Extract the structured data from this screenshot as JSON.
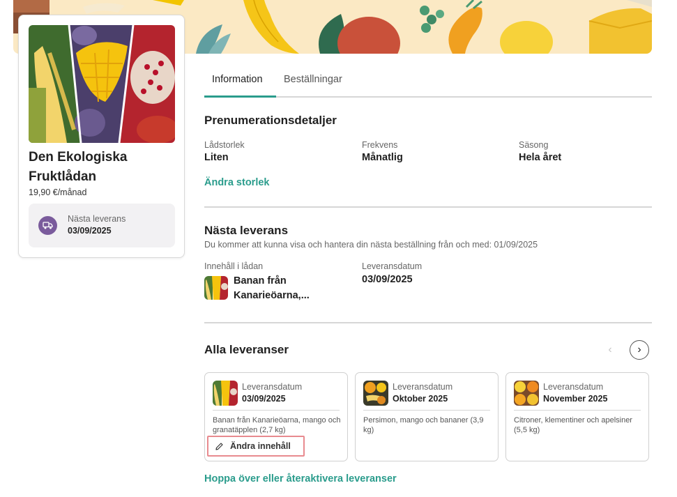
{
  "product": {
    "title": "Den Ekologiska Fruktlådan",
    "price": "19,90 €/månad",
    "next_delivery_label": "Nästa leverans",
    "next_delivery_date": "03/09/2025"
  },
  "tabs": [
    {
      "label": "Information",
      "active": true
    },
    {
      "label": "Beställningar",
      "active": false
    }
  ],
  "subscription": {
    "title": "Prenumerationsdetaljer",
    "fields": [
      {
        "label": "Lådstorlek",
        "value": "Liten"
      },
      {
        "label": "Frekvens",
        "value": "Månatlig"
      },
      {
        "label": "Säsong",
        "value": "Hela året"
      }
    ],
    "change_size_link": "Ändra storlek"
  },
  "next_delivery": {
    "title": "Nästa leverans",
    "description": "Du kommer att kunna visa och hantera din nästa beställning från och med: 01/09/2025",
    "contents_label": "Innehåll i lådan",
    "contents_value": "Banan från Kanarieöarna,...",
    "date_label": "Leveransdatum",
    "date_value": "03/09/2025"
  },
  "all_deliveries": {
    "title": "Alla leveranser",
    "cards": [
      {
        "label": "Leveransdatum",
        "date": "03/09/2025",
        "description": "Banan från Kanarieöarna, mango och granatäpplen (2,7 kg)",
        "edit_label": "Ändra innehåll"
      },
      {
        "label": "Leveransdatum",
        "date": "Oktober 2025",
        "description": "Persimon, mango och bananer (3,9 kg)"
      },
      {
        "label": "Leveransdatum",
        "date": "November 2025",
        "description": "Citroner, klementiner och apelsiner (5,5 kg)"
      }
    ],
    "skip_link": "Hoppa över eller återaktivera leveranser"
  },
  "icons": {
    "truck": "truck-icon",
    "pencil": "pencil-icon",
    "prev": "chevron-left-icon",
    "next": "chevron-right-icon"
  },
  "colors": {
    "accent": "#2a9c8c",
    "badge_purple": "#7a5b9c",
    "highlight_border": "#e88a8f",
    "banner_bg": "#fbe9c4"
  }
}
